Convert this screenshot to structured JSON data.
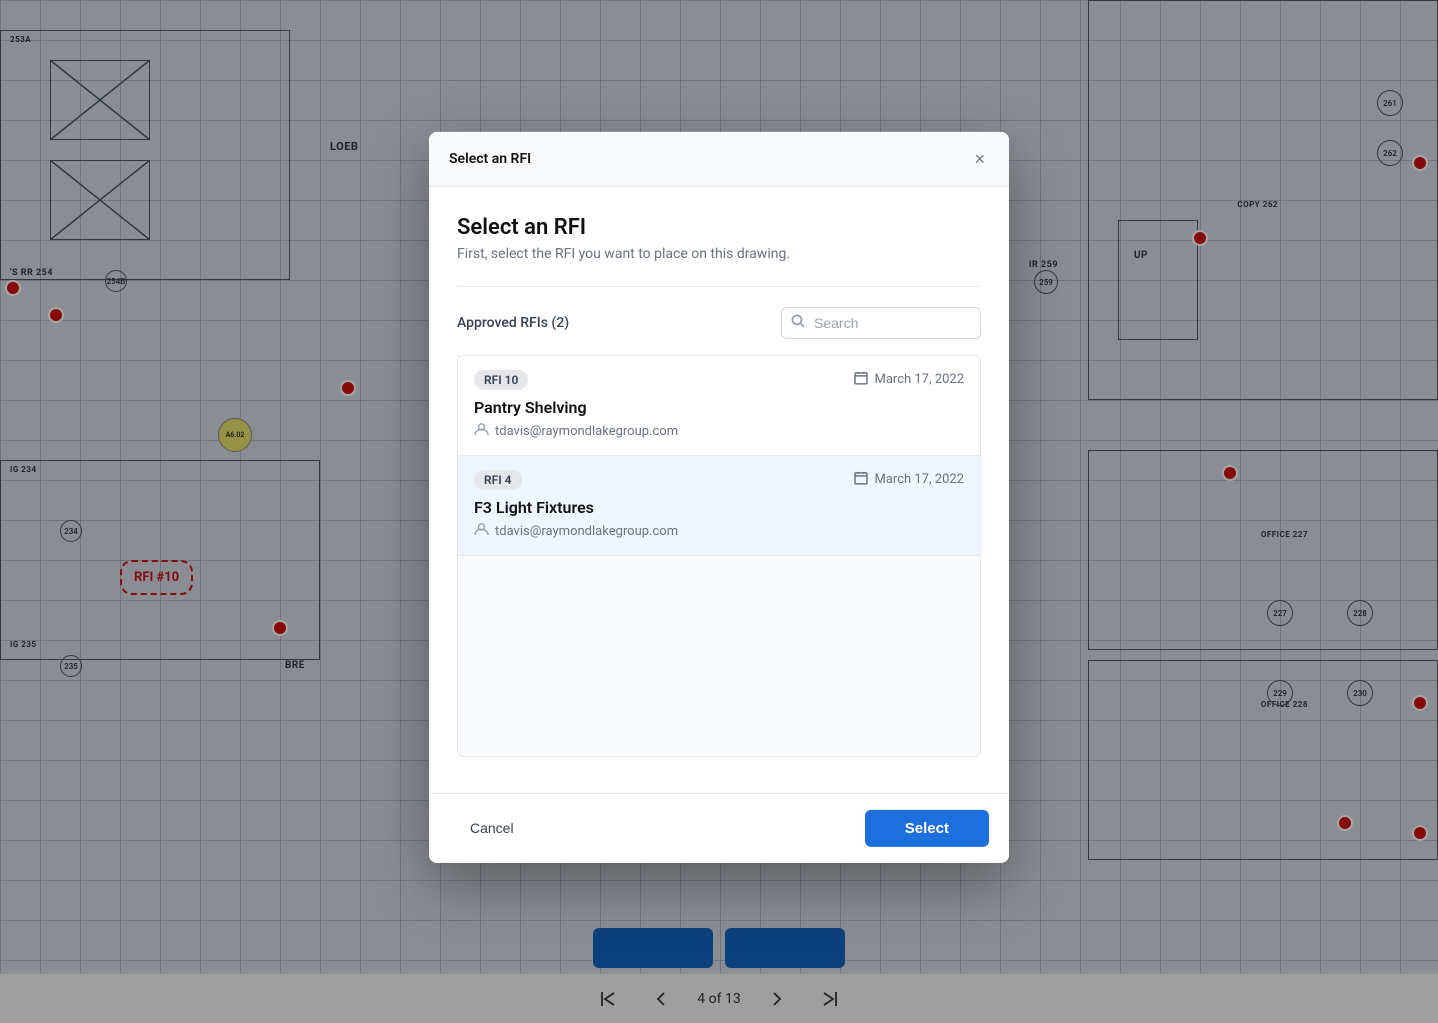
{
  "modal": {
    "header_title": "Select an RFI",
    "close_label": "×",
    "main_title": "Select an RFI",
    "subtitle": "First, select the RFI you want to place on this drawing.",
    "filter_label": "Approved RFIs (2)",
    "search_placeholder": "Search",
    "rfi_items": [
      {
        "badge": "RFI 10",
        "date": "March 17, 2022",
        "title": "Pantry Shelving",
        "author": "tdavis@raymondlakegroup.com"
      },
      {
        "badge": "RFI 4",
        "date": "March 17, 2022",
        "title": "F3 Light Fixtures",
        "author": "tdavis@raymondlakegroup.com"
      }
    ],
    "cancel_label": "Cancel",
    "select_label": "Select"
  },
  "nav": {
    "page_info": "4 of 13"
  },
  "blueprint": {
    "rfi_annotation": "RFI\n#10",
    "room_labels": [
      "OFFICE 227",
      "OFFICE 228",
      "COPY 262"
    ],
    "room_numbers": [
      "253A",
      "254B",
      "259",
      "234",
      "235",
      "229",
      "227",
      "228",
      "261",
      "262"
    ]
  }
}
